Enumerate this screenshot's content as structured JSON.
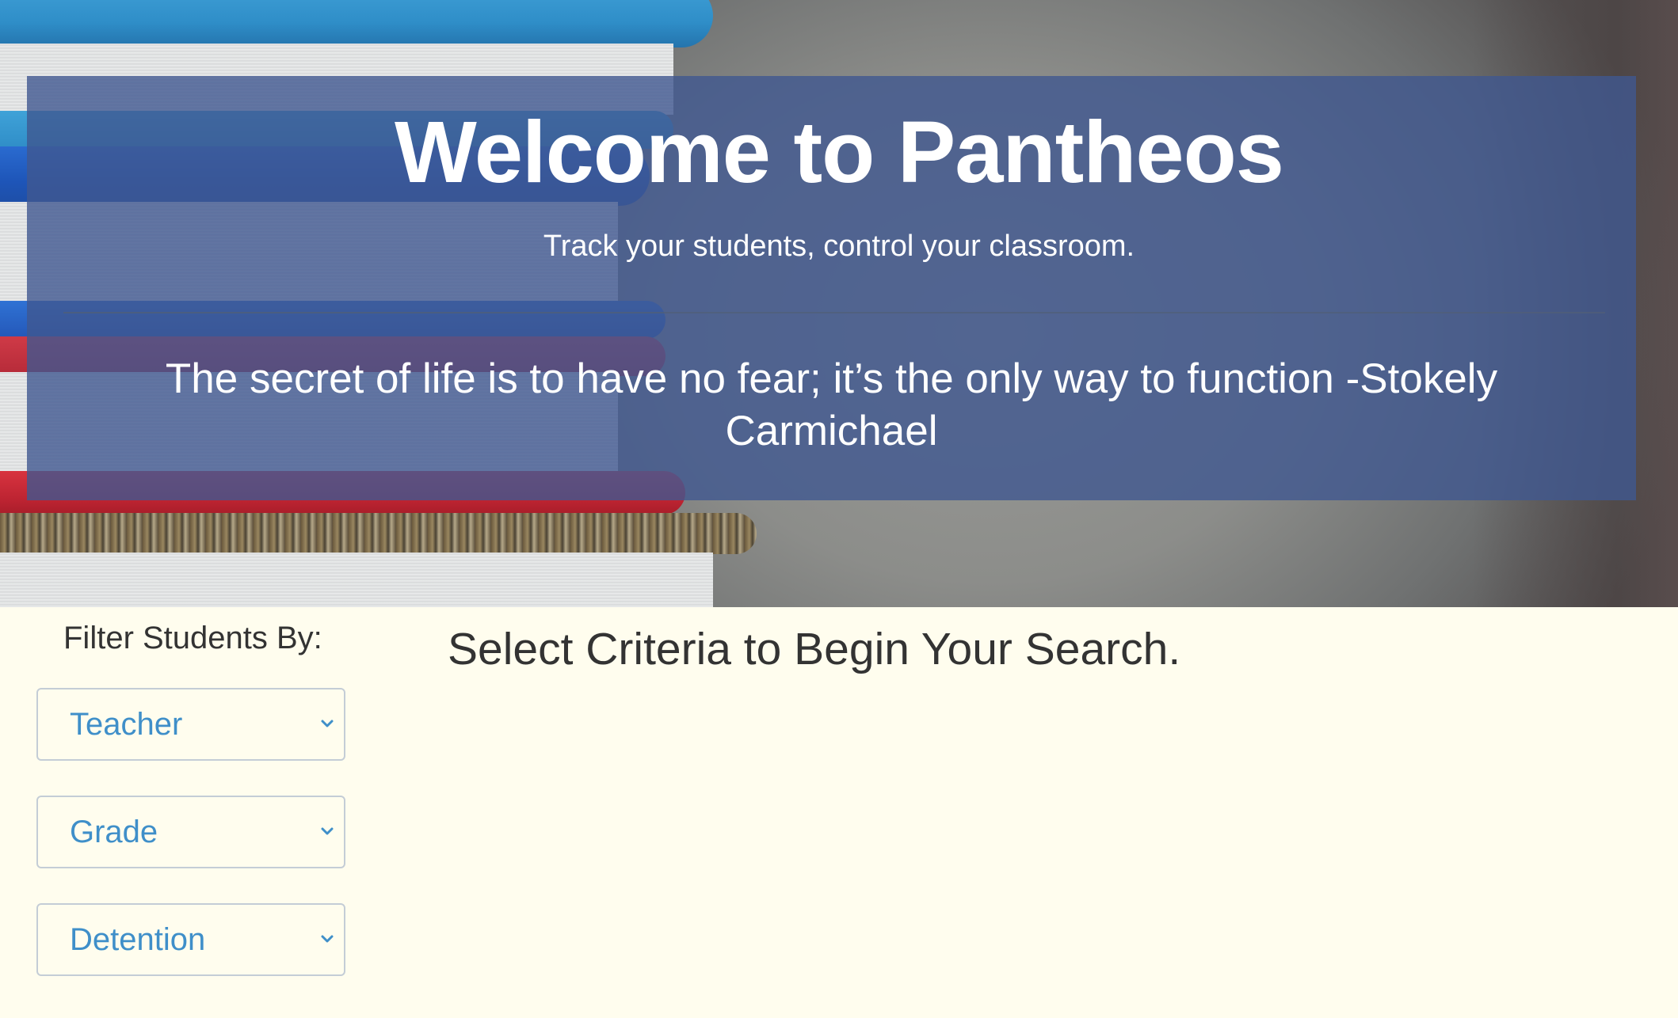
{
  "hero": {
    "title": "Welcome to Pantheos",
    "subtitle": "Track your students, control your classroom.",
    "quote_line1": "The secret of life is to have no fear; it’s the only way to function -Stokely",
    "quote_line2": "Carmichael"
  },
  "filters": {
    "label": "Filter Students By:",
    "teacher_select": "Teacher",
    "grade_select": "Grade",
    "detention_select": "Detention"
  },
  "main": {
    "message": "Select Criteria to Begin Your Search."
  },
  "colors": {
    "page_background": "#fffdee",
    "overlay": "#405790",
    "select_text": "#3f8fc9",
    "body_text": "#333333"
  },
  "icons": {
    "select_chevron": "chevron-down-icon"
  }
}
